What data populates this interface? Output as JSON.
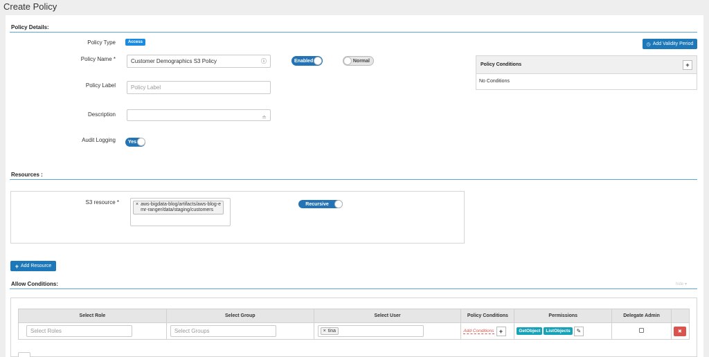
{
  "page": {
    "title": "Create Policy"
  },
  "policy_details": {
    "heading": "Policy Details:",
    "policy_type_label": "Policy Type",
    "policy_type_value": "Access",
    "policy_name_label": "Policy Name *",
    "policy_name_value": "Customer Demographics S3 Policy",
    "enabled_toggle": "Enabled",
    "normal_toggle": "Normal",
    "policy_label_label": "Policy Label",
    "policy_label_placeholder": "Policy Label",
    "description_label": "Description",
    "audit_logging_label": "Audit Logging",
    "audit_logging_value": "Yes",
    "add_validity_button": "Add Validity Period",
    "conditions_title": "Policy Conditions",
    "conditions_add": "+",
    "conditions_empty": "No Conditions"
  },
  "resources": {
    "heading": "Resources :",
    "s3_label": "S3 resource *",
    "s3_tag_remove": "×",
    "s3_value_line1": "aws-bigdata-blog/artifacts/aws-blog-e",
    "s3_value_line2": "mr-ranger/data/staging/customers",
    "recursive_toggle": "Recursive",
    "add_resource_button": "Add Resource"
  },
  "allow_conditions": {
    "heading": "Allow Conditions:",
    "hide_link": "hide",
    "columns": [
      "Select Role",
      "Select Group",
      "Select User",
      "Policy Conditions",
      "Permissions",
      "Delegate Admin"
    ],
    "row": {
      "role_placeholder": "Select Roles",
      "group_placeholder": "Select Groups",
      "user_tag_remove": "×",
      "user_value": "tina",
      "add_conditions": "Add Conditions",
      "add_conditions_plus": "+",
      "permissions": [
        "GetObject",
        "ListObjects"
      ],
      "delete": "✖"
    }
  }
}
